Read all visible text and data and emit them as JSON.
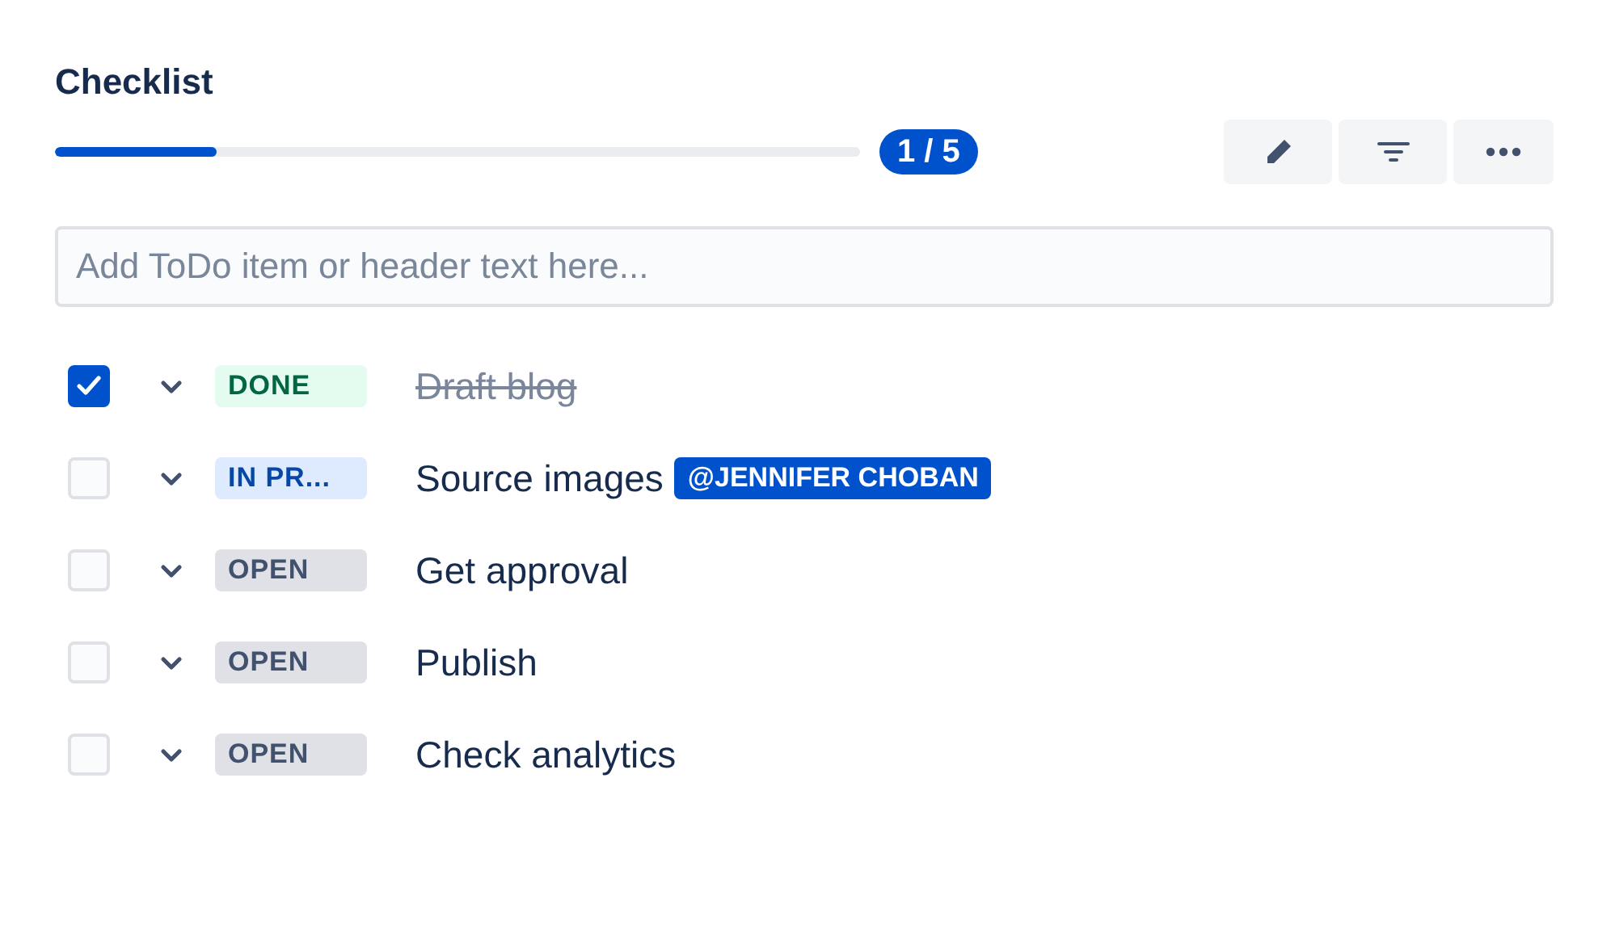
{
  "title": "Checklist",
  "progress": {
    "level": 0.2,
    "count": "1 / 5"
  },
  "toolbar": [
    {
      "kind": "edit"
    },
    {
      "kind": "filter"
    },
    {
      "kind": "more"
    }
  ],
  "input": {
    "placeholder": "Add ToDo item or header text here..."
  },
  "items": [
    {
      "checked": true,
      "status": {
        "kind": "done",
        "label": "DONE"
      },
      "text": "Draft blog"
    },
    {
      "checked": false,
      "status": {
        "kind": "inprogress",
        "label": "IN PR..."
      },
      "text": "Source images",
      "mention": "@JENNIFER CHOBAN"
    },
    {
      "checked": false,
      "status": {
        "kind": "open",
        "label": "OPEN"
      },
      "text": "Get approval"
    },
    {
      "checked": false,
      "status": {
        "kind": "open",
        "label": "OPEN"
      },
      "text": "Publish"
    },
    {
      "checked": false,
      "status": {
        "kind": "open",
        "label": "OPEN"
      },
      "text": "Check analytics"
    }
  ]
}
